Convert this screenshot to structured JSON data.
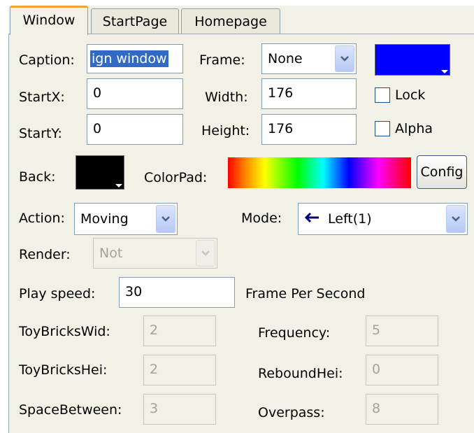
{
  "tabs": [
    "Window",
    "StartPage",
    "Homepage"
  ],
  "window": {
    "caption": {
      "label": "Caption:",
      "value": "ign window"
    },
    "frame": {
      "label": "Frame:",
      "value": "None"
    },
    "frame_color": "#0000ff",
    "startx": {
      "label": "StartX:",
      "value": "0"
    },
    "starty": {
      "label": "StartY:",
      "value": "0"
    },
    "width": {
      "label": "Width:",
      "value": "176"
    },
    "height": {
      "label": "Height:",
      "value": "176"
    },
    "lock": {
      "label": "Lock",
      "checked": false
    },
    "alpha": {
      "label": "Alpha",
      "checked": false
    },
    "back": {
      "label": "Back:",
      "color": "#000000"
    },
    "colorpad": {
      "label": "ColorPad:"
    },
    "config_label": "Config"
  },
  "action": {
    "label": "Action:",
    "value": "Moving"
  },
  "mode": {
    "label": "Mode:",
    "value": "Left(1)",
    "icon": "arrow-left-icon"
  },
  "render": {
    "label": "Render:",
    "value": "Not"
  },
  "play_speed": {
    "label": "Play speed:",
    "value": "30",
    "unit": "Frame Per Second"
  },
  "params": {
    "toy_bricks_wid": {
      "label": "ToyBricksWid:",
      "value": "2"
    },
    "toy_bricks_hei": {
      "label": "ToyBricksHei:",
      "value": "2"
    },
    "space_between": {
      "label": "SpaceBetween:",
      "value": "3"
    },
    "frequency": {
      "label": "Frequency:",
      "value": "5"
    },
    "rebound_hei": {
      "label": "ReboundHei:",
      "value": "0"
    },
    "overpass": {
      "label": "Overpass:",
      "value": "8"
    }
  }
}
